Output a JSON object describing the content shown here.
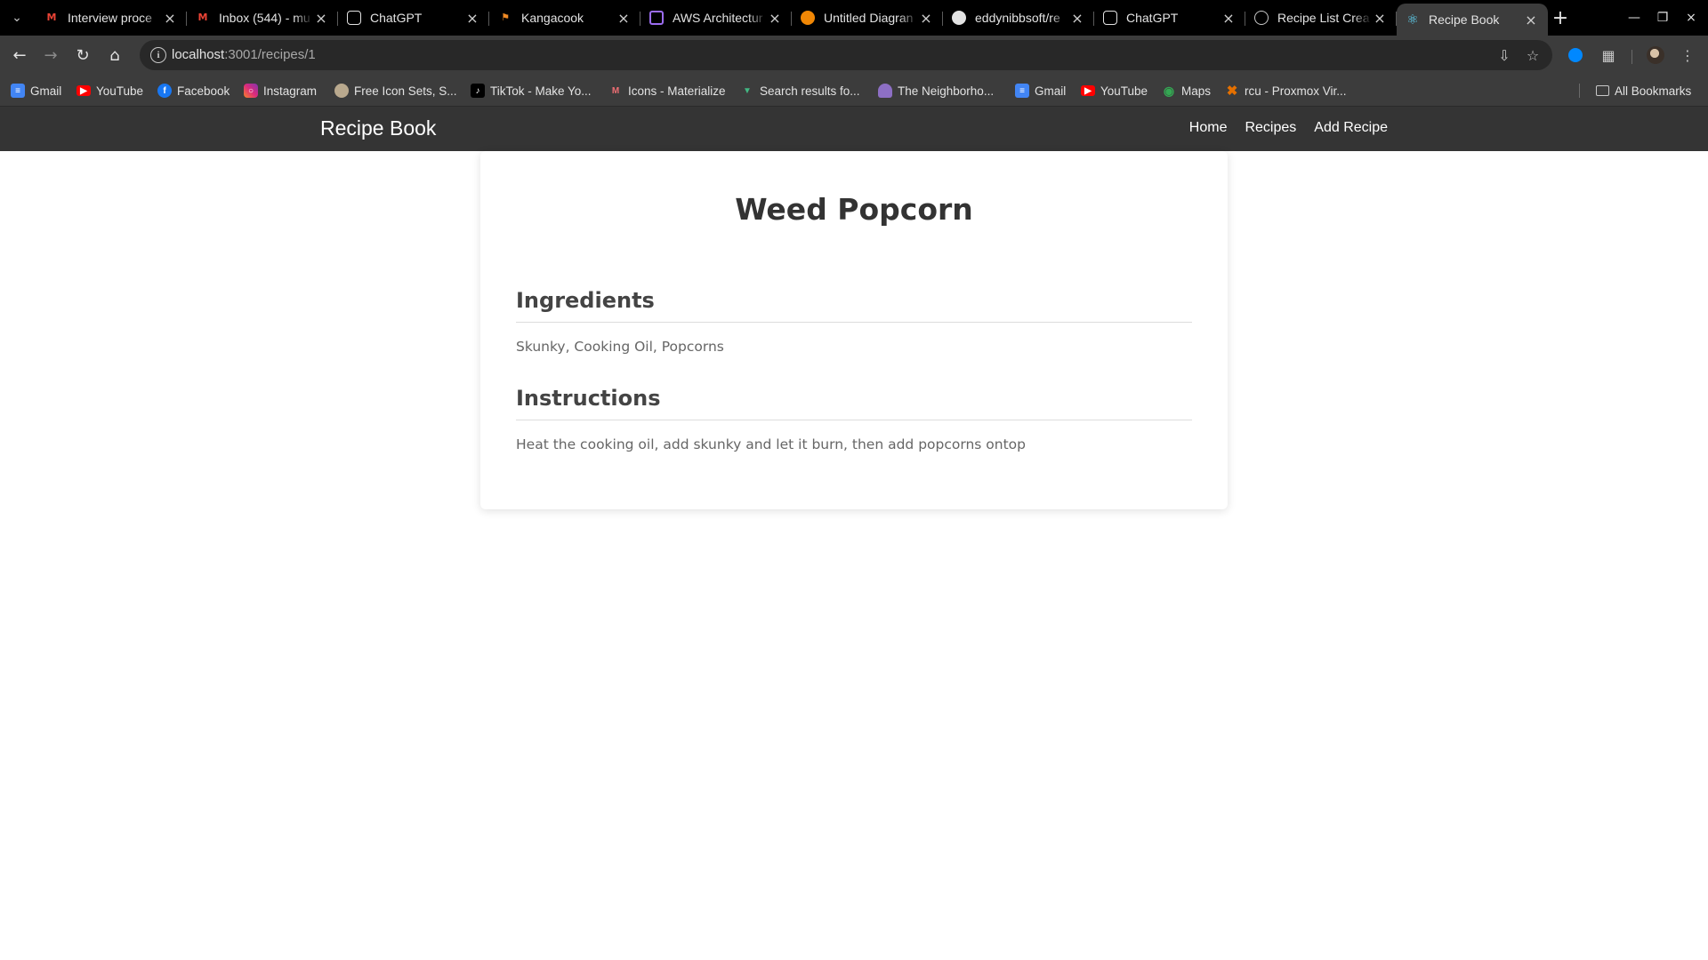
{
  "browser": {
    "tabs": [
      {
        "title": "Interview proce",
        "favicon": "gmail-icon",
        "active": false
      },
      {
        "title": "Inbox (544) - mu",
        "favicon": "gmail-icon",
        "active": false
      },
      {
        "title": "ChatGPT",
        "favicon": "chatgpt-icon",
        "active": false
      },
      {
        "title": "Kangacook",
        "favicon": "kangacook-icon",
        "active": false
      },
      {
        "title": "AWS Architectur",
        "favicon": "aws-architecture-icon",
        "active": false
      },
      {
        "title": "Untitled Diagran",
        "favicon": "drawio-icon",
        "active": false
      },
      {
        "title": "eddynibbsoft/re",
        "favicon": "github-icon",
        "active": false
      },
      {
        "title": "ChatGPT",
        "favicon": "chatgpt-icon",
        "active": false
      },
      {
        "title": "Recipe List Crea",
        "favicon": "globe-icon",
        "active": false
      },
      {
        "title": "Recipe Book",
        "favicon": "react-icon",
        "active": true
      }
    ],
    "url_host": "localhost",
    "url_path": ":3001/recipes/1",
    "bookmarks": [
      {
        "label": "Gmail",
        "icon": "google-docs-icon"
      },
      {
        "label": "YouTube",
        "icon": "youtube-icon"
      },
      {
        "label": "Facebook",
        "icon": "facebook-icon"
      },
      {
        "label": "Instagram",
        "icon": "instagram-icon"
      },
      {
        "label": "Free Icon Sets, S...",
        "icon": "icon-sets-icon"
      },
      {
        "label": "TikTok - Make Yo...",
        "icon": "tiktok-icon"
      },
      {
        "label": "Icons - Materialize",
        "icon": "materialize-icon"
      },
      {
        "label": "Search results fo...",
        "icon": "vue-icon"
      },
      {
        "label": "The Neighborho...",
        "icon": "neighborhood-icon"
      },
      {
        "label": "Gmail",
        "icon": "google-docs-icon"
      },
      {
        "label": "YouTube",
        "icon": "youtube-icon"
      },
      {
        "label": "Maps",
        "icon": "maps-icon"
      },
      {
        "label": "rcu - Proxmox Vir...",
        "icon": "proxmox-icon"
      }
    ],
    "all_bookmarks": "All Bookmarks"
  },
  "app": {
    "brand": "Recipe Book",
    "nav": {
      "home": "Home",
      "recipes": "Recipes",
      "add": "Add Recipe"
    }
  },
  "recipe": {
    "title": "Weed Popcorn",
    "ingredients_heading": "Ingredients",
    "ingredients": "Skunky, Cooking Oil, Popcorns",
    "instructions_heading": "Instructions",
    "instructions": "Heat the cooking oil, add skunky and let it burn, then add popcorns ontop"
  },
  "colors": {
    "tabstrip_bg": "#000000",
    "toolbar_bg": "#3c3c3c",
    "app_navbar_bg": "#343434",
    "title_text": "#333333",
    "body_text": "#666666"
  }
}
